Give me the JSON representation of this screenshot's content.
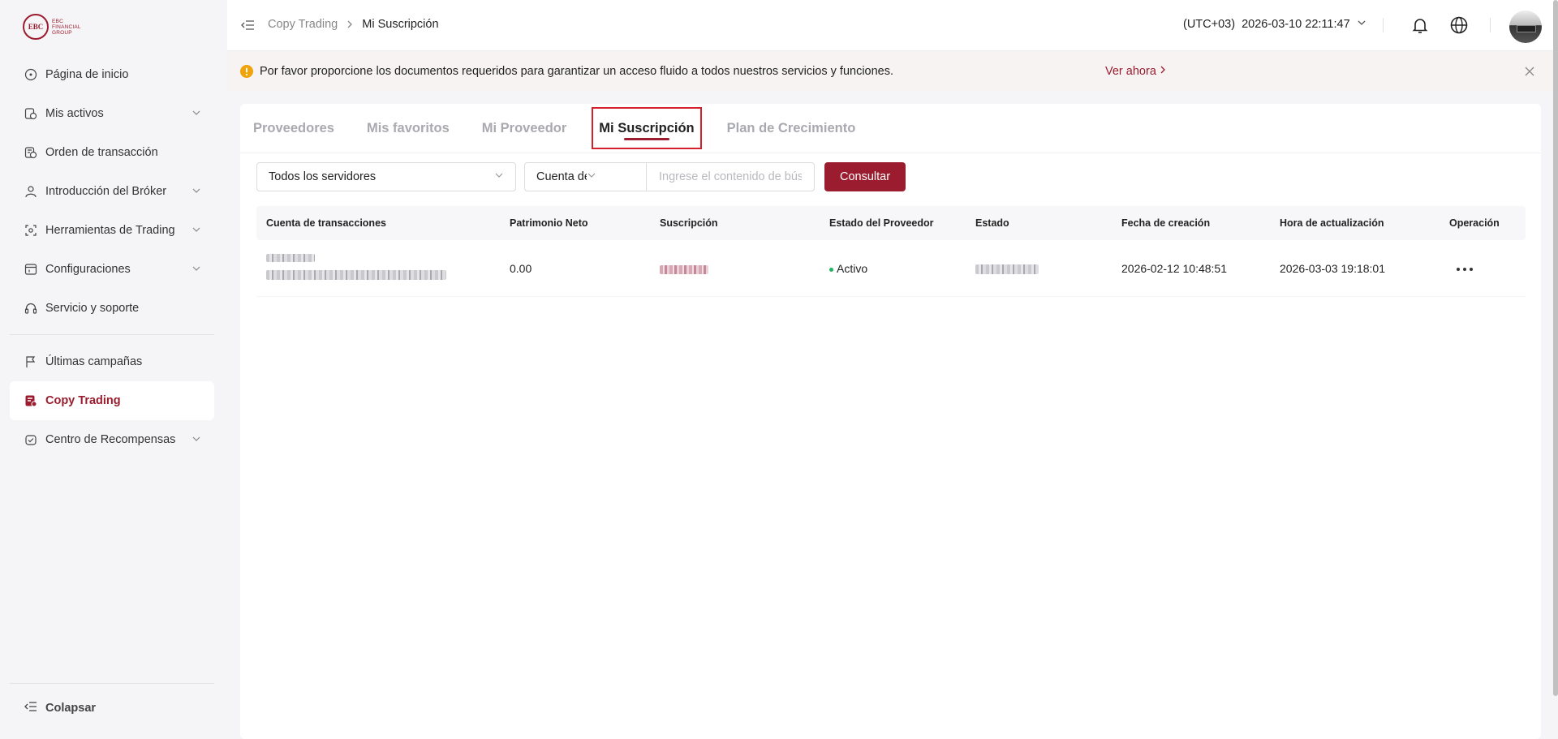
{
  "brand": {
    "logo_mark": "EBC",
    "logo_line1": "EBC",
    "logo_line2": "FINANCIAL",
    "logo_line3": "GROUP"
  },
  "sidebar": {
    "items": [
      {
        "label": "Página de inicio",
        "icon": "home-icon"
      },
      {
        "label": "Mis activos",
        "icon": "assets-icon"
      },
      {
        "label": "Orden de transacción",
        "icon": "order-icon"
      },
      {
        "label": "Introducción del Bróker",
        "icon": "broker-icon"
      },
      {
        "label": "Herramientas de Trading",
        "icon": "tools-icon"
      },
      {
        "label": "Configuraciones",
        "icon": "settings-icon"
      },
      {
        "label": "Servicio y soporte",
        "icon": "headset-icon"
      },
      {
        "label": "Últimas campañas",
        "icon": "flag-icon"
      },
      {
        "label": "Copy Trading",
        "icon": "copy-trading-icon"
      },
      {
        "label": "Centro de Recompensas",
        "icon": "rewards-icon"
      }
    ],
    "collapse_label": "Colapsar"
  },
  "header": {
    "breadcrumb": {
      "parent": "Copy Trading",
      "current": "Mi Suscripción"
    },
    "timezone": "(UTC+03)",
    "datetime": "2026-03-10 22:11:47"
  },
  "notice": {
    "text": "Por favor proporcione los documentos requeridos para garantizar un acceso fluido a todos nuestros servicios y funciones.",
    "link": "Ver ahora"
  },
  "tabs": [
    {
      "label": "Proveedores"
    },
    {
      "label": "Mis favoritos"
    },
    {
      "label": "Mi Proveedor"
    },
    {
      "label": "Mi Suscripción",
      "active": true
    },
    {
      "label": "Plan de Crecimiento"
    }
  ],
  "filters": {
    "server_select": "Todos los servidores",
    "field_select": "Cuenta de transacciones",
    "search_placeholder": "Ingrese el contenido de búsqueda",
    "query_button": "Consultar"
  },
  "table": {
    "columns": [
      "Cuenta de transacciones",
      "Patrimonio Neto",
      "Suscripción",
      "Estado del Proveedor",
      "Estado",
      "Fecha de creación",
      "Hora de actualización",
      "Operación"
    ],
    "rows": [
      {
        "net_equity": "0.00",
        "provider_status": "Activo",
        "created": "2026-02-12 10:48:51",
        "updated": "2026-03-03 19:18:01"
      }
    ]
  },
  "colors": {
    "brand": "#9b1c2e",
    "active_dot": "#1fb463",
    "warning": "#f0a30a"
  }
}
